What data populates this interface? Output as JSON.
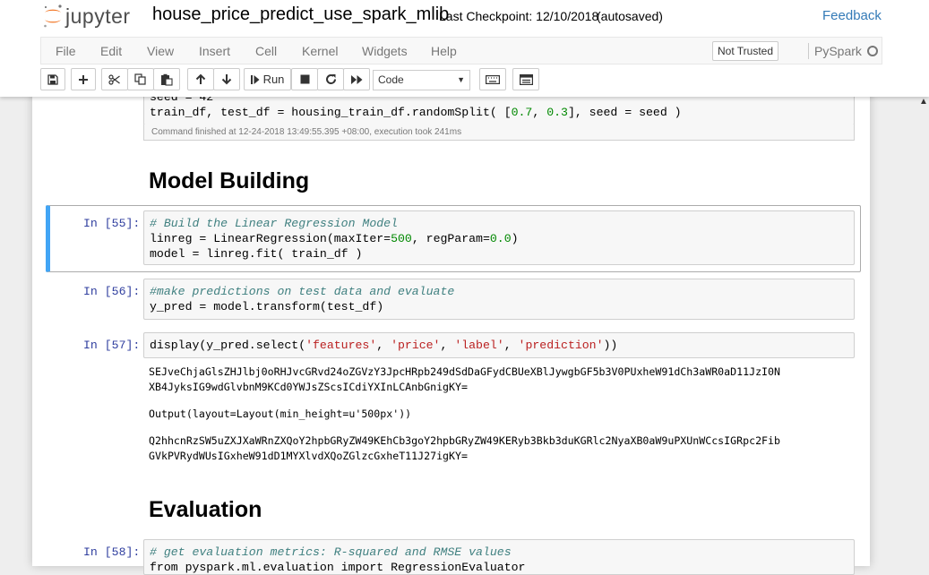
{
  "header": {
    "logo_text": "jupyter",
    "notebook_name": "house_price_predict_use_spark_mlib",
    "checkpoint": "Last Checkpoint: 12/10/2018",
    "autosaved": "(autosaved)",
    "feedback_label": "Feedback"
  },
  "menu": {
    "items": [
      "File",
      "Edit",
      "View",
      "Insert",
      "Cell",
      "Kernel",
      "Widgets",
      "Help"
    ],
    "trusted_label": "Not Trusted",
    "kernel_name": "PySpark"
  },
  "toolbar": {
    "buttons": [
      "save-icon",
      "plus-icon",
      "cut-icon",
      "copy-icon",
      "paste-icon",
      "arrow-up-icon",
      "arrow-down-icon",
      "run-icon",
      "stop-icon",
      "restart-icon",
      "fast-forward-icon",
      "keyboard-icon",
      "command-palette-icon"
    ],
    "run_label": "Run",
    "cell_type": "Code"
  },
  "cells": {
    "prev": {
      "line1": "seed = 42",
      "line2_a": "train_df, test_df = ",
      "line2_b": "housing_train_df.randomSplit( [",
      "line2_c1": "0.7",
      "line2_c2": ", ",
      "line2_c3": "0.3",
      "line2_d": "], seed = seed )",
      "exec_time": "Command finished at 12-24-2018 13:49:55.395 +08:00, execution took 241ms"
    },
    "heading_model": "Model Building",
    "c55": {
      "prompt": "In [55]:",
      "comment": "# Build the Linear Regression Model",
      "l2_a": "linreg = LinearRegression(maxIter=",
      "l2_n1": "500",
      "l2_b": ", regParam=",
      "l2_n2": "0.0",
      "l2_c": ")",
      "l3": "model = linreg.fit( train_df )"
    },
    "c56": {
      "prompt": "In [56]:",
      "comment": "#make predictions on test data and evaluate",
      "l2": "y_pred = model.transform(test_df)"
    },
    "c57": {
      "prompt": "In [57]:",
      "code_a": "display(y_pred.select(",
      "s1": "'features'",
      "sep": ", ",
      "s2": "'price'",
      "s3": "'label'",
      "s4": "'prediction'",
      "code_b": "))",
      "out1a": "SEJveChjaGlsZHJlbj0oRHJvcGRvd24oZGVzY3JpcHRpb249dSdDaGFydCBUeXBlJywgbGF5b3V0PUxheW91dCh3aWR0aD11JzI0N",
      "out1b": "XB4JyksIG9wdGlvbnM9KCd0YWJsZScsICdiYXInLCAnbGnigKY=",
      "out2": "Output(layout=Layout(min_height=u'500px'))",
      "out3a": "Q2hhcnRzSW5uZXJXaWRnZXQoY2hpbGRyZW49KEhCb3goY2hpbGRyZW49KERyb3Bkb3duKGRlc2NyaXB0aW9uPXUnWCcsIGRpc2Fib",
      "out3b": "GVkPVRydWUsIGxheW91dD1MYXlvdXQoZGlzcGxheT11J27igKY="
    },
    "heading_eval": "Evaluation",
    "c58": {
      "prompt": "In [58]:",
      "comment": "# get evaluation metrics: R-squared and RMSE values",
      "l2": "from pyspark.ml.evaluation import RegressionEvaluator"
    }
  }
}
